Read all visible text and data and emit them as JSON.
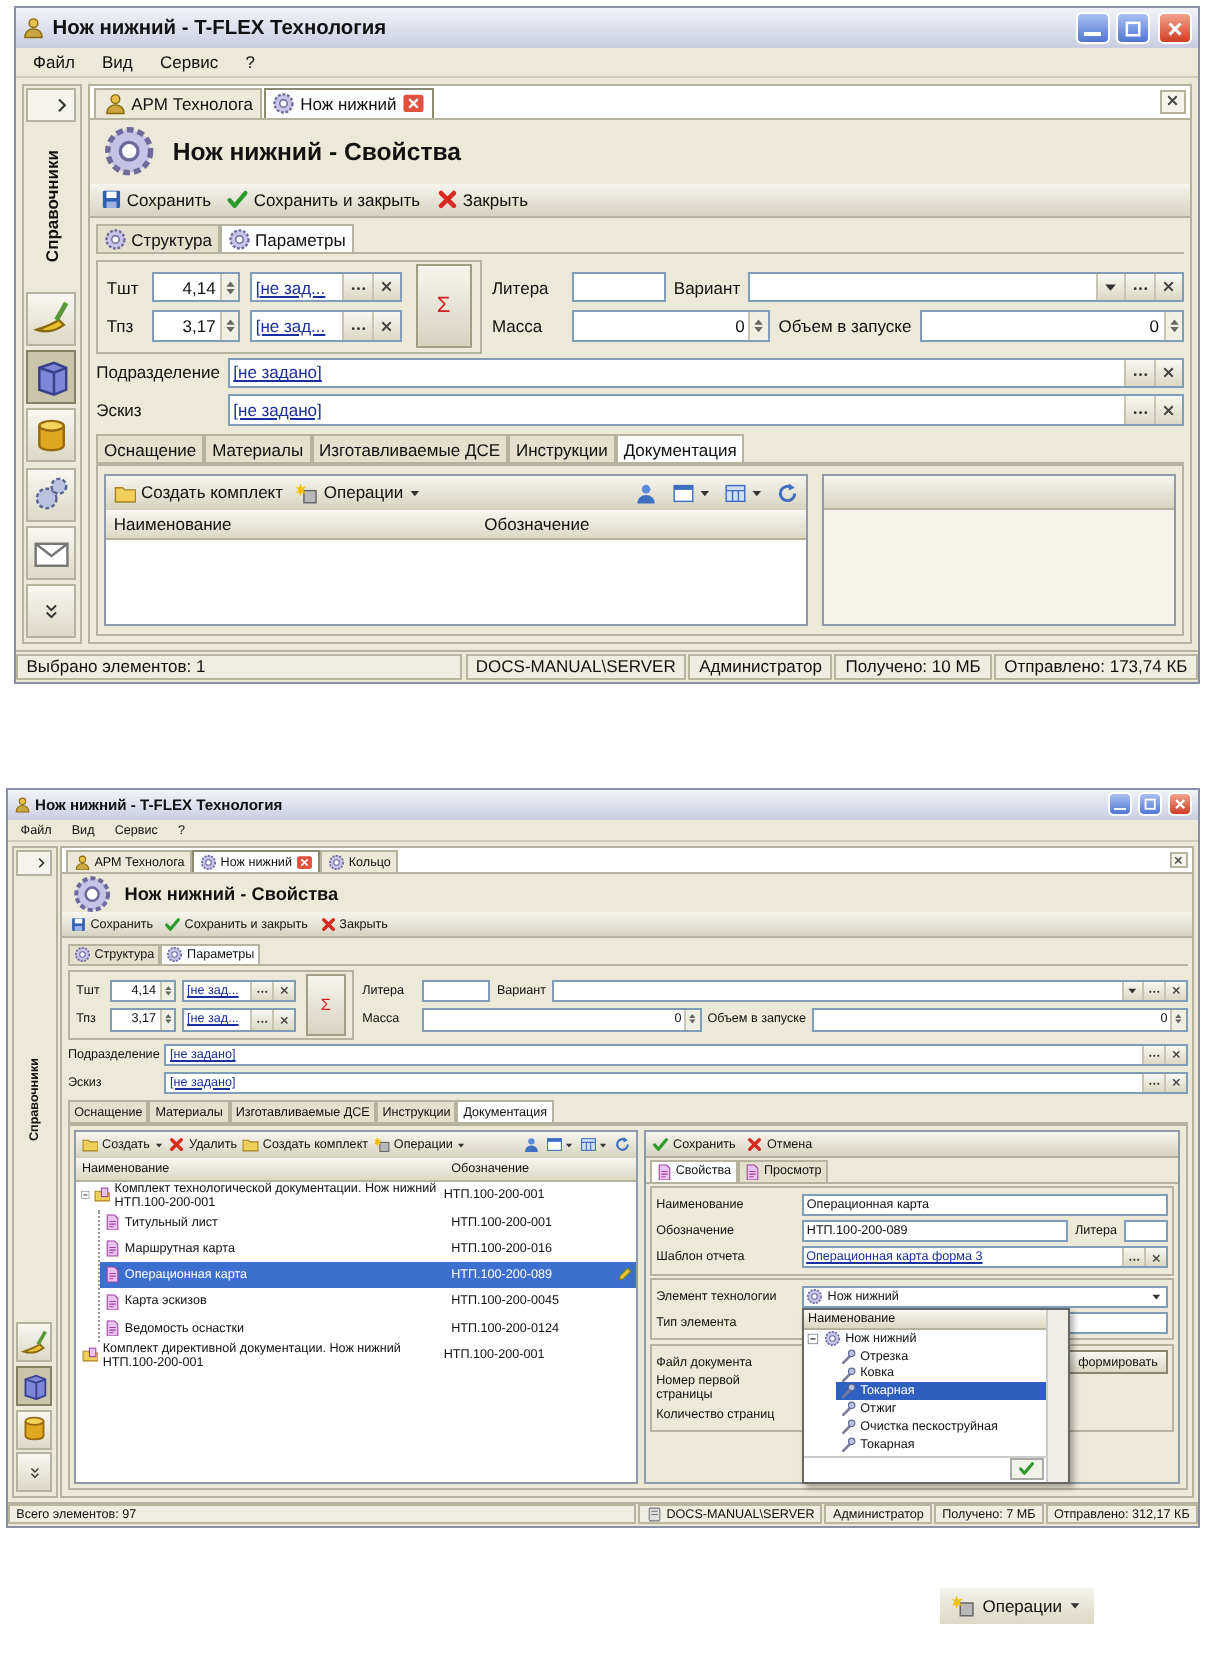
{
  "windows": [
    {
      "title": "Нож нижний - T-FLEX Технология",
      "menu": [
        "Файл",
        "Вид",
        "Сервис",
        "?"
      ],
      "sidebar": {
        "label": "Справочники",
        "items": [
          {
            "kind": "brush",
            "selected": false
          },
          {
            "kind": "cube",
            "selected": true
          },
          {
            "kind": "barrel",
            "selected": false
          },
          {
            "kind": "gears",
            "selected": false
          },
          {
            "kind": "envelope",
            "selected": false
          }
        ]
      },
      "tabs": [
        {
          "label": "АРМ Технолога",
          "kind": "user",
          "selected": false,
          "closable": false
        },
        {
          "label": "Нож нижний",
          "kind": "gear",
          "selected": true,
          "closable": true
        }
      ],
      "heading": "Нож нижний - Свойства",
      "actions": [
        {
          "label": "Сохранить",
          "kind": "save"
        },
        {
          "label": "Сохранить и закрыть",
          "kind": "check"
        },
        {
          "label": "Закрыть",
          "kind": "cross"
        }
      ],
      "sub_tabs": [
        {
          "label": "Структура",
          "selected": false
        },
        {
          "label": "Параметры",
          "selected": true
        }
      ],
      "params": {
        "times": [
          {
            "label": "Тшт",
            "value": "4,14",
            "link": "[не зад..."
          },
          {
            "label": "Тпз",
            "value": "3,17",
            "link": "[не зад..."
          }
        ],
        "sum": "Σ",
        "litera": "Литера",
        "variant": "Вариант",
        "mass": {
          "label": "Масса",
          "value": "0"
        },
        "volume": {
          "label": "Объем в запуске",
          "value": "0"
        }
      },
      "fields": [
        {
          "label": "Подразделение",
          "value": "[не задано]"
        },
        {
          "label": "Эскиз",
          "value": "[не задано]"
        }
      ],
      "section_tabs": [
        {
          "label": "Оснащение",
          "selected": false
        },
        {
          "label": "Материалы",
          "selected": false
        },
        {
          "label": "Изготавливаемые ДСЕ",
          "selected": false
        },
        {
          "label": "Инструкции",
          "selected": false
        },
        {
          "label": "Документация",
          "selected": true
        }
      ],
      "doc_toolbar": [
        {
          "label": "Создать комплект",
          "kind": "folder",
          "dropdown": false
        },
        {
          "label": "Операции",
          "kind": "ops",
          "dropdown": true
        }
      ],
      "table": {
        "columns": [
          "Наименование",
          "Обозначение"
        ]
      },
      "status_bar": [
        {
          "text": "Выбрано элементов: 1",
          "icon": false
        },
        {
          "text": "DOCS-MANUAL\\SERVER",
          "icon": false
        },
        {
          "text": "Администратор",
          "icon": false
        },
        {
          "text": "Получено: 10 МБ",
          "icon": false
        },
        {
          "text": "Отправлено: 173,74 КБ",
          "icon": false
        }
      ]
    },
    {
      "title": "Нож нижний - T-FLEX Технология",
      "menu": [
        "Файл",
        "Вид",
        "Сервис",
        "?"
      ],
      "sidebar": {
        "label": "Справочники",
        "items": [
          {
            "kind": "brush",
            "selected": false
          },
          {
            "kind": "cube",
            "selected": true
          },
          {
            "kind": "barrel",
            "selected": false
          }
        ]
      },
      "tabs": [
        {
          "label": "АРМ Технолога",
          "kind": "user",
          "selected": false,
          "closable": false
        },
        {
          "label": "Нож нижний",
          "kind": "gear",
          "selected": true,
          "closable": true
        },
        {
          "label": "Кольцо",
          "kind": "gear",
          "selected": false,
          "closable": false
        }
      ],
      "heading": "Нож нижний - Свойства",
      "actions": [
        {
          "label": "Сохранить",
          "kind": "save"
        },
        {
          "label": "Сохранить и закрыть",
          "kind": "check"
        },
        {
          "label": "Закрыть",
          "kind": "cross"
        }
      ],
      "sub_tabs": [
        {
          "label": "Структура",
          "selected": false
        },
        {
          "label": "Параметры",
          "selected": true
        }
      ],
      "params": {
        "times": [
          {
            "label": "Тшт",
            "value": "4,14",
            "link": "[не зад..."
          },
          {
            "label": "Тпз",
            "value": "3,17",
            "link": "[не зад..."
          }
        ],
        "sum": "Σ",
        "litera": "Литера",
        "variant": "Вариант",
        "mass": {
          "label": "Масса",
          "value": "0"
        },
        "volume": {
          "label": "Объем в запуске",
          "value": "0"
        }
      },
      "fields": [
        {
          "label": "Подразделение",
          "value": "[не задано]"
        },
        {
          "label": "Эскиз",
          "value": "[не задано]"
        }
      ],
      "section_tabs": [
        {
          "label": "Оснащение",
          "selected": false
        },
        {
          "label": "Материалы",
          "selected": false
        },
        {
          "label": "Изготавливаемые ДСЕ",
          "selected": false
        },
        {
          "label": "Инструкции",
          "selected": false
        },
        {
          "label": "Документация",
          "selected": true
        }
      ],
      "doc_toolbar": [
        {
          "label": "Создать",
          "kind": "folder",
          "dropdown": true
        },
        {
          "label": "Удалить",
          "kind": "cross",
          "dropdown": false
        },
        {
          "label": "Создать комплект",
          "kind": "folder",
          "dropdown": false
        },
        {
          "label": "Операции",
          "kind": "ops",
          "dropdown": true
        }
      ],
      "table": {
        "columns": [
          "Наименование",
          "Обозначение"
        ],
        "rows": [
          {
            "name": "Комплект технологической документации. Нож нижний НТП.100-200-001",
            "designation": "НТП.100-200-001",
            "kind": "set",
            "selected": false,
            "children": [
              {
                "name": "Титульный лист",
                "designation": "НТП.100-200-001",
                "kind": "doc",
                "selected": false
              },
              {
                "name": "Маршрутная карта",
                "designation": "НТП.100-200-016",
                "kind": "doc",
                "selected": false
              },
              {
                "name": "Операционная карта",
                "designation": "НТП.100-200-089",
                "kind": "doc",
                "selected": true
              },
              {
                "name": "Карта эскизов",
                "designation": "НТП.100-200-0045",
                "kind": "doc",
                "selected": false
              },
              {
                "name": "Ведомость оснастки",
                "designation": "НТП.100-200-0124",
                "kind": "doc",
                "selected": false
              }
            ]
          },
          {
            "name": "Комплект директивной документации. Нож нижний НТП.100-200-001",
            "designation": "НТП.100-200-001",
            "kind": "set",
            "selected": false
          }
        ]
      },
      "detail": {
        "actions": [
          {
            "label": "Сохранить",
            "kind": "check"
          },
          {
            "label": "Отмена",
            "kind": "cross"
          }
        ],
        "tabs": [
          {
            "label": "Свойства",
            "selected": true
          },
          {
            "label": "Просмотр",
            "selected": false
          }
        ],
        "name": {
          "label": "Наименование",
          "value": "Операционная карта"
        },
        "designation": {
          "label": "Обозначение",
          "value": "НТП.100-200-089"
        },
        "litera": "Литера",
        "template": {
          "label": "Шаблон отчета",
          "value": "Операционная карта форма 3"
        },
        "element": {
          "label": "Элемент технологии",
          "value": "Нож нижний"
        },
        "element_type": "Тип элемента",
        "file": {
          "label": "Файл документа",
          "button": "формировать"
        },
        "first_page": "Номер первой страницы",
        "page_count": "Количество страниц",
        "popup": {
          "column": "Наименование",
          "root": "Нож нижний",
          "items": [
            {
              "label": "Отрезка",
              "selected": false
            },
            {
              "label": "Ковка",
              "selected": false
            },
            {
              "label": "Токарная",
              "selected": true
            },
            {
              "label": "Отжиг",
              "selected": false
            },
            {
              "label": "Очистка пескоструйная",
              "selected": false
            },
            {
              "label": "Токарная",
              "selected": false
            }
          ]
        }
      },
      "status_bar": [
        {
          "text": "Всего элементов: 97",
          "icon": false
        },
        {
          "text": "DOCS-MANUAL\\SERVER",
          "icon": true
        },
        {
          "text": "Администратор",
          "icon": false
        },
        {
          "text": "Получено: 7 МБ",
          "icon": false
        },
        {
          "text": "Отправлено: 312,17 КБ",
          "icon": false
        }
      ]
    }
  ],
  "operations_button": {
    "label": "Операции"
  }
}
